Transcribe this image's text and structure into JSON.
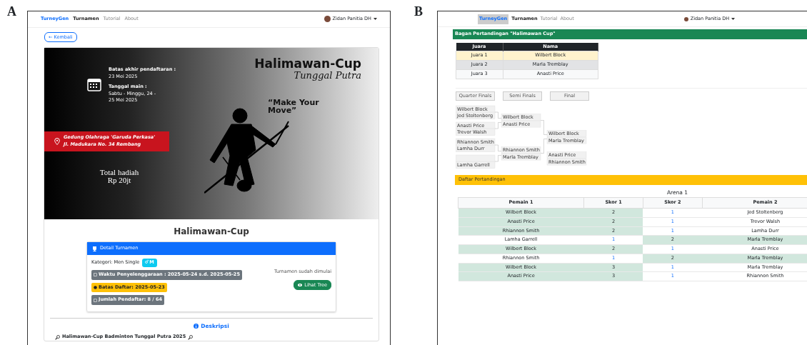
{
  "panel_a": {
    "label": "A",
    "navbar": {
      "brand": "TurneyGen",
      "links": [
        {
          "label": "Turnamen",
          "selected": true
        },
        {
          "label": "Tutorial",
          "selected": false
        },
        {
          "label": "About",
          "selected": false
        }
      ],
      "user": "Zidan Panitia DH"
    },
    "back_button": "← Kembali",
    "poster": {
      "title": "Halimawan-Cup",
      "subtitle": "Tunggal Putra",
      "deadline_label": "Batas akhir pendaftaran :",
      "deadline": "23 Mei 2025",
      "play_label": "Tanggal main :",
      "play_dates": "Sabtu - Minggu, 24 - 25 Mei 2025",
      "quote": "“Make Your Move”",
      "venue": "Gedung Olahraga 'Garuda Perkasa'",
      "address": "Jl. Madukara No. 34 Rembang",
      "prize_label": "Total hadiah",
      "prize": "Rp 20jt"
    },
    "tournament_title": "Halimawan-Cup",
    "detail": {
      "header": "Detail Turnamen",
      "category_label": "Kategori: Men Single",
      "category_badge": "M",
      "badges": [
        {
          "kind": "time",
          "text": "Waktu Penyelenggaraan : 2025-05-24 s.d. 2025-05-25",
          "color": "#6c757d"
        },
        {
          "kind": "deadline",
          "text": "Batas Daftar: 2025-05-23",
          "color": "#ffc107"
        },
        {
          "kind": "count",
          "text": "Jumlah Pendaftar: 8 / 64",
          "color": "#6c757d"
        }
      ],
      "status": "Turnamen sudah dimulai",
      "tree_button": "Lihat Tree"
    },
    "description_heading": "Deskripsi",
    "description_line": "Halimawan-Cup Badminton Tunggal Putra 2025"
  },
  "panel_b": {
    "label": "B",
    "navbar": {
      "brand": "TurneyGen",
      "links": [
        {
          "label": "Turnamen",
          "selected": true
        },
        {
          "label": "Tutorial",
          "selected": false
        },
        {
          "label": "About",
          "selected": false
        }
      ],
      "user": "Zidan Panitia DH"
    },
    "bracket_header": "Bagan Pertandingan \"Halimawan Cup\"",
    "winners": {
      "columns": [
        "Juara",
        "Nama"
      ],
      "rows": [
        {
          "rank": "Juara 1",
          "name": "Wilbert Block",
          "color": "#fff3cd"
        },
        {
          "rank": "Juara 2",
          "name": "Marla Tremblay",
          "color": "#e2e3e5"
        },
        {
          "rank": "Juara 3",
          "name": "Anasti Price",
          "color": "#f8f9fa"
        }
      ]
    },
    "round_buttons": [
      "Quarter Finals",
      "Semi Finals",
      "Final"
    ],
    "bracket": {
      "quarter_finals": [
        [
          "Wilbert Block",
          "Jed Stoltenberg"
        ],
        [
          "Anasti Price",
          "Trevor Walsh"
        ],
        [
          "Rhiannon Smith",
          "Lamha Durr"
        ],
        [
          "Lamha Garrell"
        ]
      ],
      "semi_finals": [
        [
          "Wilbert Block",
          "Anasti Price"
        ],
        [
          "Rhiannon Smith",
          "Marla Tremblay"
        ]
      ],
      "final": [
        "Wilbert Block",
        "Marla Tremblay"
      ],
      "third_place": [
        "Anasti Price",
        "Rhiannon Smith"
      ]
    },
    "matches_header": "Daftar Pertandingan",
    "arena": "Arena 1",
    "matches": {
      "columns": [
        "Pemain 1",
        "Skor 1",
        "Skor 2",
        "Pemain 2"
      ],
      "rows": [
        {
          "player_1": "Wilbert Block",
          "score_1": "2",
          "score_2": "1",
          "player_2": "Jed Stoltenberg",
          "player_1_won": true
        },
        {
          "player_1": "Anasti Price",
          "score_1": "2",
          "score_2": "1",
          "player_2": "Trevor Walsh",
          "player_1_won": true
        },
        {
          "player_1": "Rhiannon Smith",
          "score_1": "2",
          "score_2": "1",
          "player_2": "Lamha Durr",
          "player_1_won": true
        },
        {
          "player_1": "Lamha Garrell",
          "score_1": "1",
          "score_2": "2",
          "player_2": "Marla Tremblay",
          "player_1_won": false
        },
        {
          "player_1": "Wilbert Block",
          "score_1": "2",
          "score_2": "1",
          "player_2": "Anasti Price",
          "player_1_won": true
        },
        {
          "player_1": "Rhiannon Smith",
          "score_1": "1",
          "score_2": "2",
          "player_2": "Marla Tremblay",
          "player_1_won": false
        },
        {
          "player_1": "Wilbert Block",
          "score_1": "3",
          "score_2": "1",
          "player_2": "Marla Tremblay",
          "player_1_won": true
        },
        {
          "player_1": "Anasti Price",
          "score_1": "3",
          "score_2": "1",
          "player_2": "Rhiannon Smith",
          "player_1_won": true
        }
      ]
    }
  }
}
